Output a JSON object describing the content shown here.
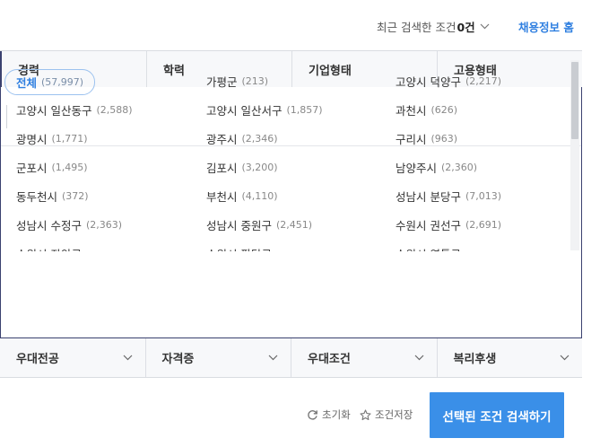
{
  "header": {
    "recent_label": "최근 검색한 조건",
    "recent_count": "0건",
    "home_link": "채용정보 홈"
  },
  "tabs": [
    {
      "label": "경력"
    },
    {
      "label": "학력"
    },
    {
      "label": "기업형태"
    },
    {
      "label": "고용형태"
    }
  ],
  "regions": [
    {
      "name": "전체",
      "count": "(57,997)",
      "selected": true
    },
    {
      "name": "가평군",
      "count": "(213)"
    },
    {
      "name": "고양시 덕양구",
      "count": "(2,217)"
    },
    {
      "name": "고양시 일산동구",
      "count": "(2,588)"
    },
    {
      "name": "고양시 일산서구",
      "count": "(1,857)"
    },
    {
      "name": "과천시",
      "count": "(626)"
    },
    {
      "name": "광명시",
      "count": "(1,771)"
    },
    {
      "name": "광주시",
      "count": "(2,346)"
    },
    {
      "name": "구리시",
      "count": "(963)"
    },
    {
      "name": "군포시",
      "count": "(1,495)"
    },
    {
      "name": "김포시",
      "count": "(3,200)"
    },
    {
      "name": "남양주시",
      "count": "(2,360)"
    },
    {
      "name": "동두천시",
      "count": "(372)"
    },
    {
      "name": "부천시",
      "count": "(4,110)"
    },
    {
      "name": "성남시 분당구",
      "count": "(7,013)"
    },
    {
      "name": "성남시 수정구",
      "count": "(2,363)"
    },
    {
      "name": "성남시 중원구",
      "count": "(2,451)"
    },
    {
      "name": "수원시 권선구",
      "count": "(2,691)"
    },
    {
      "name": "수원시 장안구",
      "count": ""
    },
    {
      "name": "수원시 팔달구",
      "count": ""
    },
    {
      "name": "수원시 영통구",
      "count": ""
    }
  ],
  "filters": [
    {
      "label": "우대전공"
    },
    {
      "label": "자격증"
    },
    {
      "label": "우대조건"
    },
    {
      "label": "복리후생"
    }
  ],
  "actions": {
    "reset_label": "초기화",
    "save_label": "조건저장",
    "search_label": "선택된 조건 검색하기"
  },
  "colors": {
    "accent": "#3a8fe8",
    "link": "#2f7fe0",
    "border_active": "#3b4270"
  },
  "icons": {
    "recent_toggle": "chevron-down-icon",
    "filter_toggle": "chevron-down-icon",
    "reset": "refresh-icon",
    "save": "star-outline-icon"
  }
}
